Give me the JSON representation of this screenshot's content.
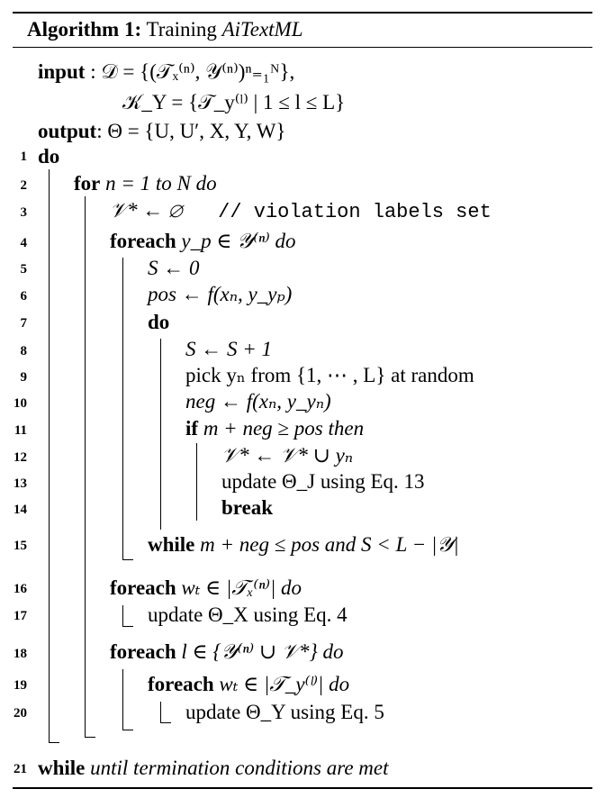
{
  "title": {
    "label": "Algorithm 1:",
    "text": "Training",
    "name": "AiTextML"
  },
  "io": {
    "input_kw": "input",
    "input_line1": ": 𝒟 = {(𝒯ₓ⁽ⁿ⁾, 𝒴⁽ⁿ⁾)ⁿ₌₁ᴺ},",
    "input_line2": "𝒦_Y = {𝒯_y⁽ˡ⁾ | 1 ≤ l ≤ L}",
    "output_kw": "output",
    "output_line": ": Θ = {U, U′, X, Y, W}"
  },
  "lines": [
    {
      "n": "1",
      "kw": "do",
      "text": ""
    },
    {
      "n": "2",
      "kw": "for",
      "text": "n = 1 to N do"
    },
    {
      "n": "3",
      "kw": "",
      "text": "𝒱* ← ∅",
      "comment": "// violation labels set"
    },
    {
      "n": "4",
      "kw": "foreach",
      "text": "y_p ∈ 𝒴⁽ⁿ⁾ do"
    },
    {
      "n": "5",
      "kw": "",
      "text": "S ← 0"
    },
    {
      "n": "6",
      "kw": "",
      "text": "pos ← f(xₙ, y_yₚ)"
    },
    {
      "n": "7",
      "kw": "do",
      "text": ""
    },
    {
      "n": "8",
      "kw": "",
      "text": "S ← S + 1"
    },
    {
      "n": "9",
      "kw": "",
      "text": "pick yₙ from {1, ⋯ , L} at random"
    },
    {
      "n": "10",
      "kw": "",
      "text": "neg ← f(xₙ, y_yₙ)"
    },
    {
      "n": "11",
      "kw": "if",
      "text": "m + neg ≥ pos then"
    },
    {
      "n": "12",
      "kw": "",
      "text": "𝒱* ← 𝒱* ∪ yₙ"
    },
    {
      "n": "13",
      "kw": "",
      "text": "update Θ_J using Eq. 13"
    },
    {
      "n": "14",
      "kw": "break",
      "text": ""
    },
    {
      "n": "15",
      "kw": "while",
      "text": "m + neg ≤ pos and S < L − |𝒴|"
    },
    {
      "n": "16",
      "kw": "foreach",
      "text": "wₜ ∈ |𝒯ₓ⁽ⁿ⁾| do"
    },
    {
      "n": "17",
      "kw": "",
      "text": "update Θ_X using Eq. 4"
    },
    {
      "n": "18",
      "kw": "foreach",
      "text": "l ∈ {𝒴⁽ⁿ⁾ ∪ 𝒱*} do"
    },
    {
      "n": "19",
      "kw": "foreach",
      "text": "wₜ ∈ |𝒯_y⁽ˡ⁾| do"
    },
    {
      "n": "20",
      "kw": "",
      "text": "update Θ_Y using Eq. 5"
    },
    {
      "n": "21",
      "kw": "while",
      "text": "until termination conditions are met"
    }
  ]
}
